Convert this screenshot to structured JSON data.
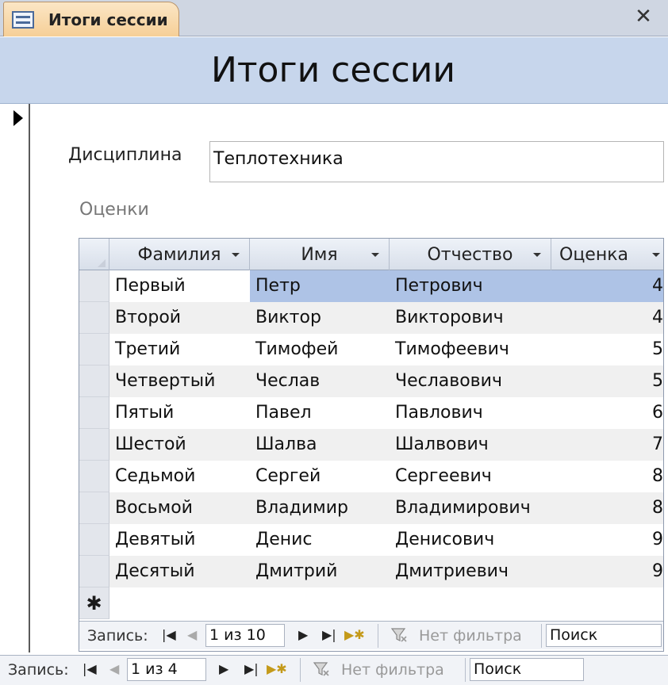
{
  "tab": {
    "title": "Итоги сессии",
    "close_glyph": "✕"
  },
  "form": {
    "title": "Итоги сессии"
  },
  "discipline": {
    "label": "Дисциплина",
    "value": "Теплотехника"
  },
  "grades": {
    "label": "Оценки",
    "columns": [
      "Фамилия",
      "Имя",
      "Отчество",
      "Оценка"
    ],
    "rows": [
      [
        "Первый",
        "Петр",
        "Петрович",
        "4"
      ],
      [
        "Второй",
        "Виктор",
        "Викторович",
        "4"
      ],
      [
        "Третий",
        "Тимофей",
        "Тимофеевич",
        "5"
      ],
      [
        "Четвертый",
        "Чеслав",
        "Чеславович",
        "5"
      ],
      [
        "Пятый",
        "Павел",
        "Павлович",
        "6"
      ],
      [
        "Шестой",
        "Шалва",
        "Шалвович",
        "7"
      ],
      [
        "Седьмой",
        "Сергей",
        "Сергеевич",
        "8"
      ],
      [
        "Восьмой",
        "Владимир",
        "Владимирович",
        "8"
      ],
      [
        "Девятый",
        "Денис",
        "Денисович",
        "9"
      ],
      [
        "Десятый",
        "Дмитрий",
        "Дмитриевич",
        "9"
      ]
    ],
    "new_row_marker": "✱"
  },
  "sub_nav": {
    "label": "Запись:",
    "position": "1 из 10",
    "filter": "Нет фильтра",
    "search": "Поиск"
  },
  "main_nav": {
    "label": "Запись:",
    "position": "1 из 4",
    "filter": "Нет фильтра",
    "search": "Поиск"
  },
  "icons": {
    "first": "|◀",
    "prev": "◀",
    "next": "▶",
    "last": "▶|",
    "new": "▶✱"
  },
  "colors": {
    "header": "#c7d6ec",
    "highlight": "#aec3e6",
    "tab": "#f6cf97"
  }
}
